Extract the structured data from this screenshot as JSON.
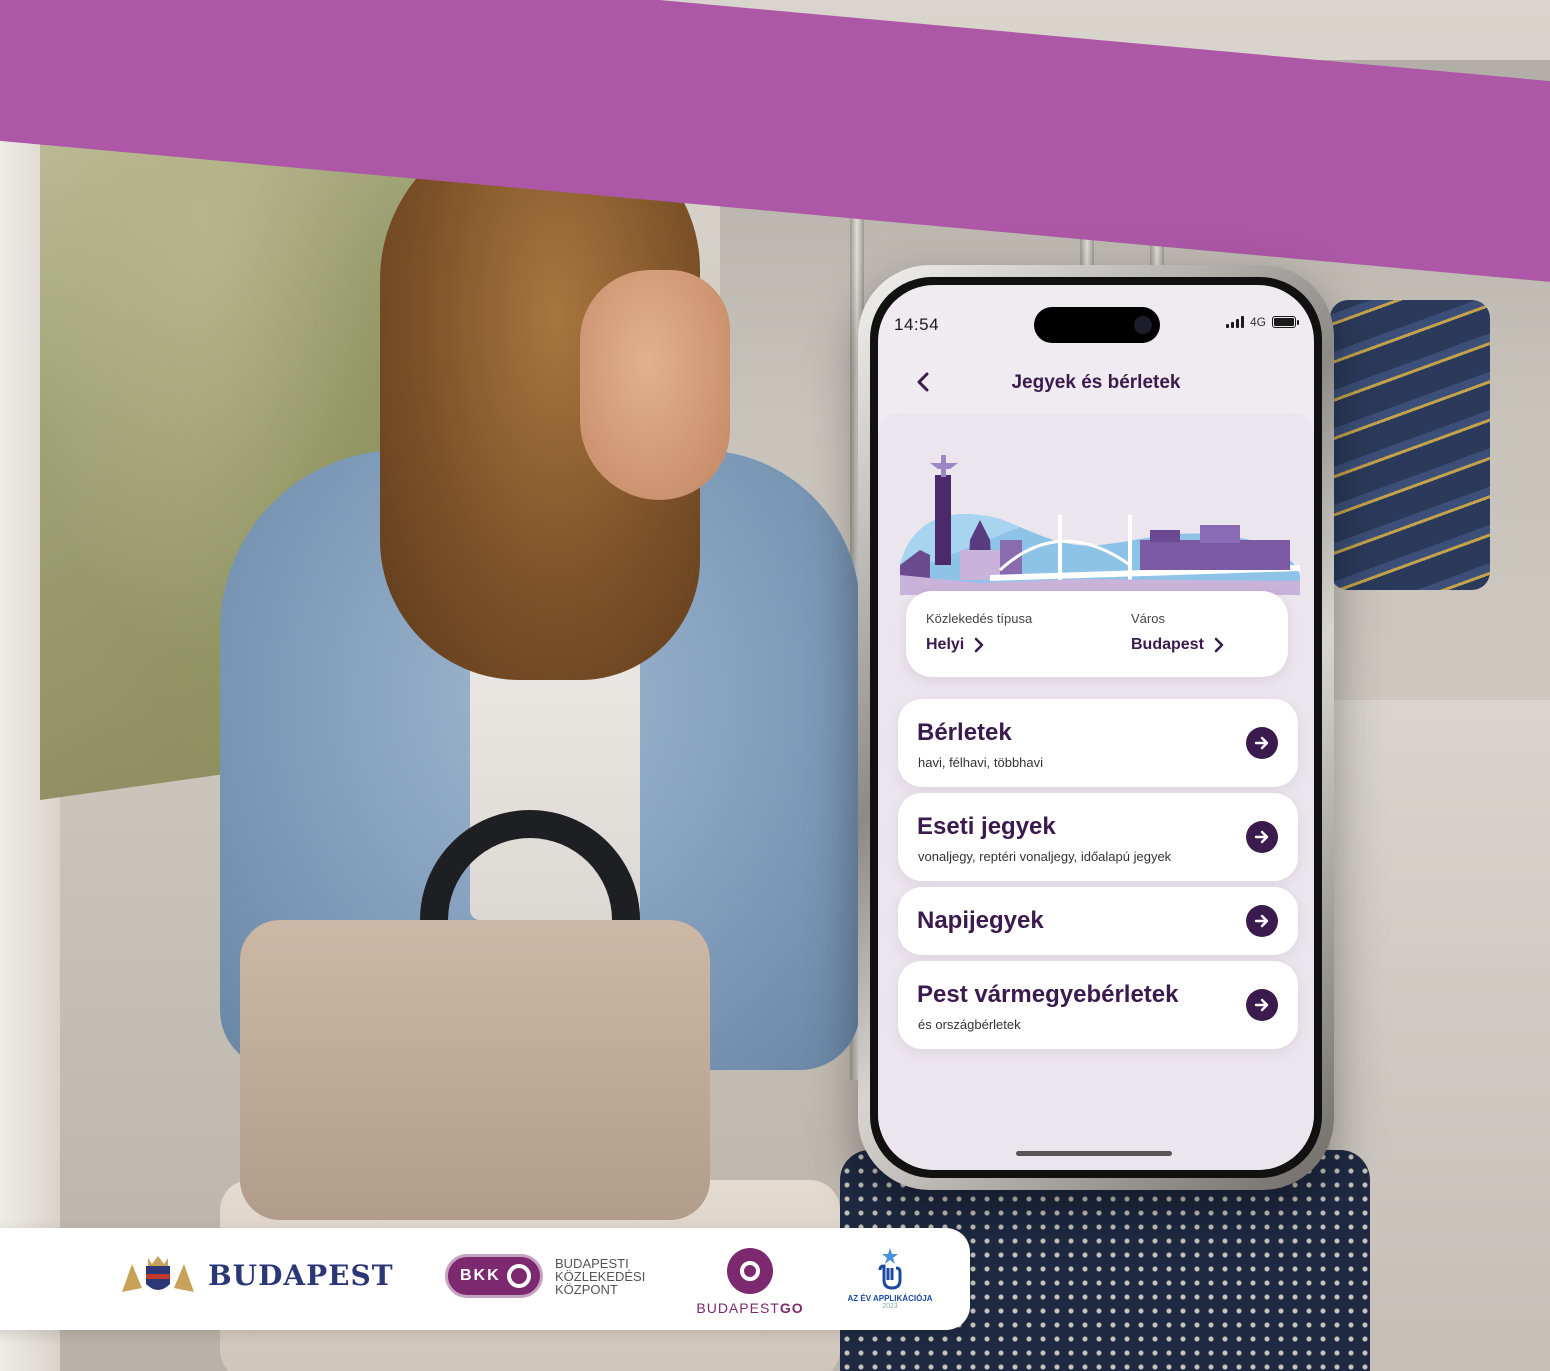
{
  "phone": {
    "status_bar": {
      "time": "14:54",
      "network": "4G",
      "icons": [
        "signal-icon",
        "battery-icon"
      ]
    },
    "header": {
      "back_icon": "chevron-left-icon",
      "title": "Jegyek és bérletek"
    },
    "filters": [
      {
        "label": "Közlekedés típusa",
        "value": "Helyi"
      },
      {
        "label": "Város",
        "value": "Budapest"
      }
    ],
    "menu": [
      {
        "title": "Bérletek",
        "subtitle": "havi, félhavi, többhavi"
      },
      {
        "title": "Eseti jegyek",
        "subtitle": "vonaljegy, reptéri vonaljegy, időalapú jegyek"
      },
      {
        "title": "Napijegyek",
        "subtitle": ""
      },
      {
        "title": "Pest vármegyebérletek",
        "subtitle": "és országbérletek"
      }
    ],
    "colors": {
      "primary": "#3b1a4e",
      "background": "#ebe5ed",
      "card": "#ffffff"
    }
  },
  "footer": {
    "budapest_logo": "BUDAPEST",
    "bkk_badge": "BKK",
    "bkk_lines": [
      "BUDAPESTI",
      "KÖZLEKEDÉSI",
      "KÖZPONT"
    ],
    "go_logo_light": "BUDAPEST",
    "go_logo_bold": "GO",
    "award_text": "AZ ÉV APPLIKÁCIÓJA",
    "award_year": "2023"
  },
  "brand": {
    "band_color": "#ac58a6",
    "bkk_purple": "#7d2970",
    "budapest_blue": "#2c3776"
  }
}
